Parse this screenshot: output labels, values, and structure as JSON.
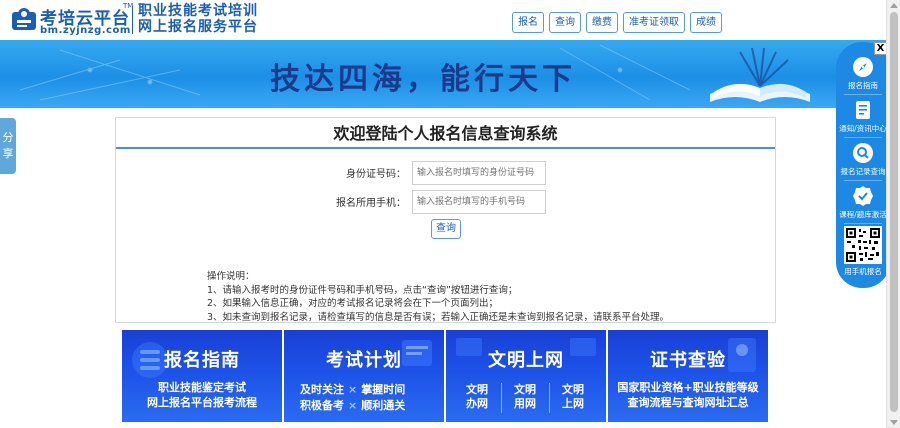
{
  "header": {
    "logo_title": "考培云平台",
    "logo_tm": "TM",
    "logo_domain": "bm.zyjnzg.com",
    "slogan_line1": "职业技能考试培训",
    "slogan_line2": "网上报名服务平台",
    "nav": [
      "报名",
      "查询",
      "缴费",
      "准考证领取",
      "成绩"
    ]
  },
  "banner": {
    "slogan": "技达四海，能行天下"
  },
  "share_tab": {
    "char1": "分",
    "char2": "享"
  },
  "form": {
    "title": "欢迎登陆个人报名信息查询系统",
    "id_label": "身份证号码：",
    "id_placeholder": "输入报名时填写的身份证号码",
    "id_value": "",
    "phone_label": "报名所用手机：",
    "phone_placeholder": "输入报名时填写的手机号码",
    "phone_value": "",
    "query_button": "查询",
    "instructions": {
      "heading": "操作说明：",
      "items": [
        "1、请输入报考时的身份证件号码和手机号码，点击“查询”按钮进行查询；",
        "2、如果输入信息正确，对应的考试报名记录将会在下一个页面列出；",
        "3、如未查询到报名记录，请检查填写的信息是否有误；若输入正确还是未查询到报名记录，请联系平台处理。"
      ]
    }
  },
  "sidepanel": {
    "close": "X",
    "items": [
      {
        "label": "报名指南",
        "icon": "compass-icon"
      },
      {
        "label": "通知/资讯中心",
        "icon": "document-icon"
      },
      {
        "label": "报名记录查询",
        "icon": "search-icon"
      },
      {
        "label": "课程/题库激活",
        "icon": "verified-badge-icon"
      },
      {
        "label": "用手机报名",
        "icon": "qr-code-icon"
      }
    ]
  },
  "cards": [
    {
      "title": "报名指南",
      "lines": [
        "职业技能鉴定考试",
        "网上报名平台报考流程"
      ]
    },
    {
      "title": "考试计划",
      "rows": [
        [
          "及时关注",
          "掌握时间"
        ],
        [
          "积极备考",
          "顺利通关"
        ]
      ]
    },
    {
      "title": "文明上网",
      "cols": [
        [
          "文明",
          "办网"
        ],
        [
          "文明",
          "用网"
        ],
        [
          "文明",
          "上网"
        ]
      ]
    },
    {
      "title": "证书查验",
      "lines": [
        "国家职业资格+职业技能等级",
        "查询流程与查询网址汇总"
      ]
    }
  ],
  "colors": {
    "brand": "#1a5fb4",
    "banner": "#1c8fe6",
    "sidepanel": "#1e88e5",
    "card": "#1d52e8"
  }
}
